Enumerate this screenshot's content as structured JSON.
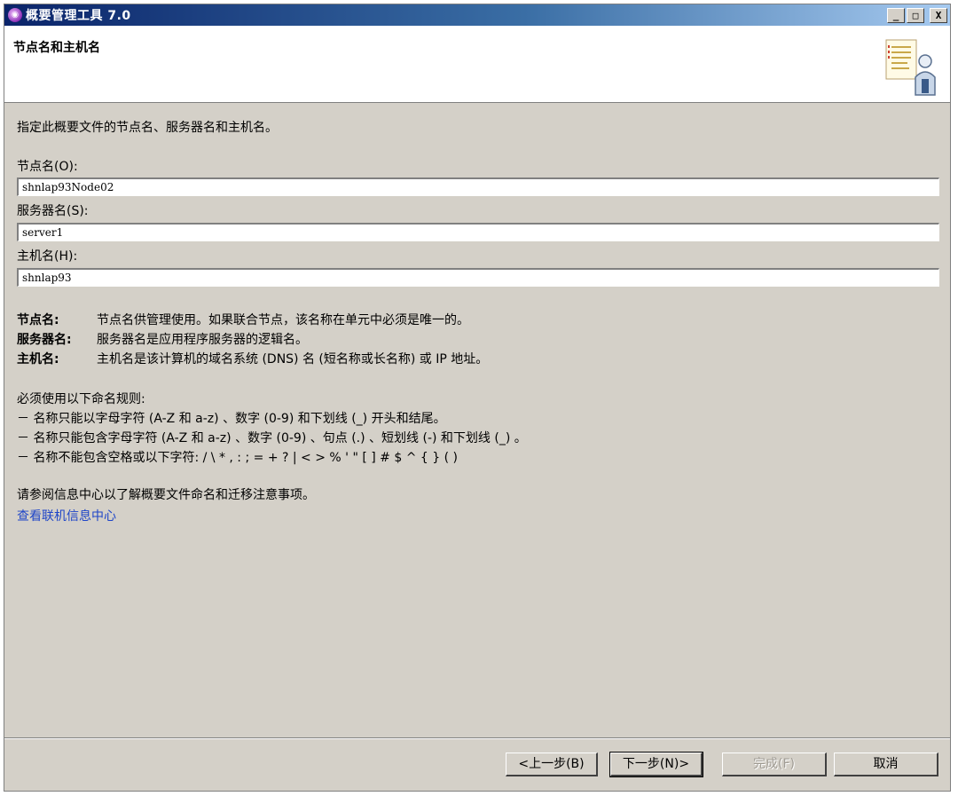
{
  "window": {
    "title": "概要管理工具 7.0",
    "icon": "app-icon",
    "controls": {
      "minimize": "_",
      "maximize": "□",
      "close": "X"
    }
  },
  "header": {
    "title": "节点名和主机名"
  },
  "main": {
    "description": "指定此概要文件的节点名、服务器名和主机名。",
    "fields": [
      {
        "label": "节点名(O):",
        "value": "shnlap93Node02"
      },
      {
        "label": "服务器名(S):",
        "value": "server1"
      },
      {
        "label": "主机名(H):",
        "value": "shnlap93"
      }
    ],
    "info": [
      {
        "key": "节点名:",
        "text": "节点名供管理使用。如果联合节点，该名称在单元中必须是唯一的。"
      },
      {
        "key": "服务器名:",
        "text": "服务器名是应用程序服务器的逻辑名。"
      },
      {
        "key": "主机名:",
        "text": "主机名是该计算机的域名系统 (DNS) 名 (短名称或长名称) 或 IP 地址。"
      }
    ],
    "rules_title": "必须使用以下命名规则:",
    "rules": [
      "－ 名称只能以字母字符 (A-Z 和 a-z) 、数字 (0-9) 和下划线 (_) 开头和结尾。",
      "－ 名称只能包含字母字符 (A-Z 和 a-z) 、数字 (0-9) 、句点 (.) 、短划线 (-) 和下划线 (_) 。",
      "－ 名称不能包含空格或以下字符: / \\ * , : ; = + ? | < > % ' \" [ ] # $ ^ { } ( )"
    ],
    "refer_text": "请参阅信息中心以了解概要文件命名和迁移注意事项。",
    "link_text": "查看联机信息中心"
  },
  "footer": {
    "back_label": "<上一步(B)",
    "next_label": "下一步(N)>",
    "finish_label": "完成(F)",
    "cancel_label": "取消"
  }
}
